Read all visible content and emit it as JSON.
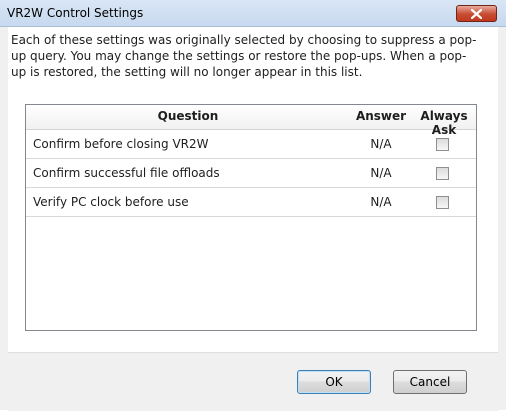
{
  "window": {
    "title": "VR2W Control Settings"
  },
  "description": "Each of these settings was originally selected by choosing to suppress a pop-up query. You may change the settings or restore the pop-ups. When a pop-up is restored, the setting will no longer appear in this list.",
  "table": {
    "columns": [
      "Question",
      "Answer",
      "Always Ask"
    ],
    "rows": [
      {
        "question": "Confirm before closing VR2W",
        "answer": "N/A",
        "always_ask": false
      },
      {
        "question": "Confirm successful file offloads",
        "answer": "N/A",
        "always_ask": false
      },
      {
        "question": "Verify PC clock before use",
        "answer": "N/A",
        "always_ask": false
      }
    ]
  },
  "buttons": {
    "ok": "OK",
    "cancel": "Cancel"
  },
  "icons": {
    "close": "close-icon"
  },
  "colors": {
    "close_button": "#c74c33",
    "title_bar": "#c7d9ef"
  }
}
